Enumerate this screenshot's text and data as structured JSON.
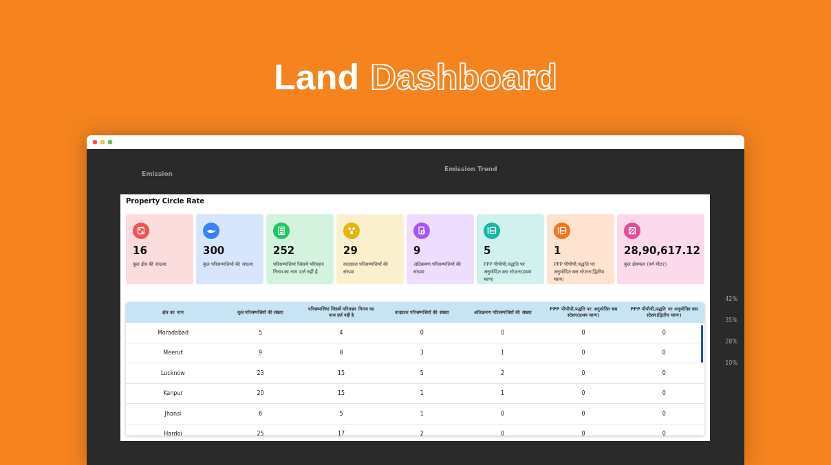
{
  "headline": {
    "plain": "Land",
    "outlined": "Dashboard"
  },
  "background_dashboard": {
    "left_title": "Emission",
    "right_title": "Emission Trend",
    "percentages": [
      "42%",
      "35%",
      "28%",
      "10%"
    ]
  },
  "modal": {
    "title": "Property Circle Rate",
    "cards": [
      {
        "color": "#f05454",
        "value": "16",
        "label": "कुल क्षेत्र की संख्या"
      },
      {
        "color": "#3b82f6",
        "value": "300",
        "label": "कुल परिसम्पत्तियों की संख्या"
      },
      {
        "color": "#22c55e",
        "value": "252",
        "label": "परिसम्पत्तियां जिसमें परिवहन निगम का नाम दर्ज नहीं है"
      },
      {
        "color": "#eab308",
        "value": "29",
        "label": "वादग्रस्त परिसम्पत्तियों की संख्या"
      },
      {
        "color": "#a855f7",
        "value": "9",
        "label": "अतिक्रमण परिसम्पत्तियों की संख्या"
      },
      {
        "color": "#14b8a6",
        "value": "5",
        "label": "PPP पीपीपी,पद्धति पर अनुमोदित बस स्टेशन(प्रथम चरण)"
      },
      {
        "color": "#f97316",
        "value": "1",
        "label": "PPP पीपीपी,पद्धति पर अनुमोदित बस स्टेशन(द्वितीय चरण)"
      },
      {
        "color": "#ec4899",
        "value": "28,90,617.12",
        "label": "कुल क्षेत्रफल (वर्ग मीटर)"
      }
    ],
    "table": {
      "columns": [
        "क्षेत्र का नाम",
        "कुल परिसम्पत्तियों की संख्या",
        "परिसम्पत्तियां जिसमें परिवहन निगम का नाम दर्ज नहीं है",
        "वादग्रस्त परिसम्पत्तियों की संख्या",
        "अतिक्रमण परिसम्पत्तियों की संख्या",
        "PPP पीपीपी,पद्धति पर अनुमोदित बस स्टेशन(प्रथम चरण)",
        "PPP पीपीपी,पद्धति पर अनुमोदित बस स्टेशन(द्वितीय चरण)"
      ],
      "rows": [
        [
          "Moradabad",
          "5",
          "4",
          "0",
          "0",
          "0",
          "0"
        ],
        [
          "Meerut",
          "9",
          "8",
          "3",
          "1",
          "0",
          "0"
        ],
        [
          "Lucknow",
          "23",
          "15",
          "5",
          "2",
          "0",
          "0"
        ],
        [
          "Kanpur",
          "20",
          "15",
          "1",
          "1",
          "0",
          "0"
        ],
        [
          "Jhansi",
          "6",
          "5",
          "1",
          "0",
          "0",
          "0"
        ],
        [
          "Hardoi",
          "25",
          "17",
          "2",
          "0",
          "0",
          "0"
        ]
      ]
    }
  }
}
